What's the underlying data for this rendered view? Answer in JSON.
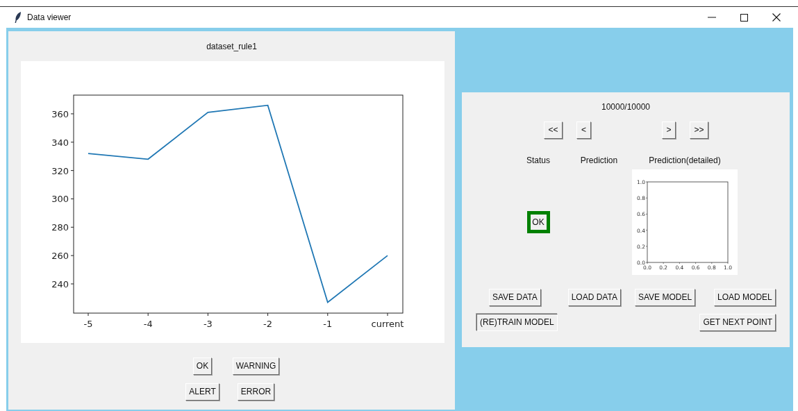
{
  "window": {
    "title": "Data viewer"
  },
  "left_panel": {
    "title": "dataset_rule1",
    "chart_data": {
      "type": "line",
      "categories": [
        "-5",
        "-4",
        "-3",
        "-2",
        "-1",
        "current"
      ],
      "series": [
        {
          "color": "#1f77b4",
          "values": [
            332,
            328,
            361,
            366,
            227,
            260
          ]
        }
      ],
      "ylim": [
        219.4,
        373.2
      ],
      "yticks": [
        240,
        260,
        280,
        300,
        320,
        340,
        360
      ]
    },
    "label_buttons": [
      {
        "label": "OK"
      },
      {
        "label": "WARNING"
      },
      {
        "label": "ALERT"
      },
      {
        "label": "ERROR"
      }
    ]
  },
  "right_panel": {
    "counter": "10000/10000",
    "nav_buttons": [
      {
        "label": "<<"
      },
      {
        "label": "<"
      },
      {
        "label": ">"
      },
      {
        "label": ">>"
      }
    ],
    "headers": [
      "Status",
      "Prediction",
      "Prediction(detailed)"
    ],
    "status": {
      "text": "OK",
      "color": "#008000"
    },
    "prediction_chart": {
      "chart_data": {
        "type": "line",
        "xlim": [
          0,
          1
        ],
        "ylim": [
          0,
          1
        ],
        "xticks": [
          {
            "value": 0,
            "label": "0.0"
          },
          0.2,
          0.4,
          0.6,
          0.8,
          {
            "value": 1,
            "label": "1.0"
          }
        ],
        "yticks": [
          {
            "value": 0,
            "label": "0.0"
          },
          0.2,
          0.4,
          0.6,
          0.8,
          {
            "value": 1,
            "label": "1.0"
          }
        ]
      }
    },
    "action_buttons": [
      {
        "label": "SAVE DATA",
        "pressed": false
      },
      {
        "label": "LOAD DATA",
        "pressed": false
      },
      {
        "label": "SAVE MODEL",
        "pressed": false
      },
      {
        "label": "LOAD MODEL",
        "pressed": false
      },
      {
        "label": "(RE)TRAIN MODEL",
        "pressed": true
      },
      {
        "label": "GET NEXT POINT",
        "pressed": false
      }
    ]
  }
}
